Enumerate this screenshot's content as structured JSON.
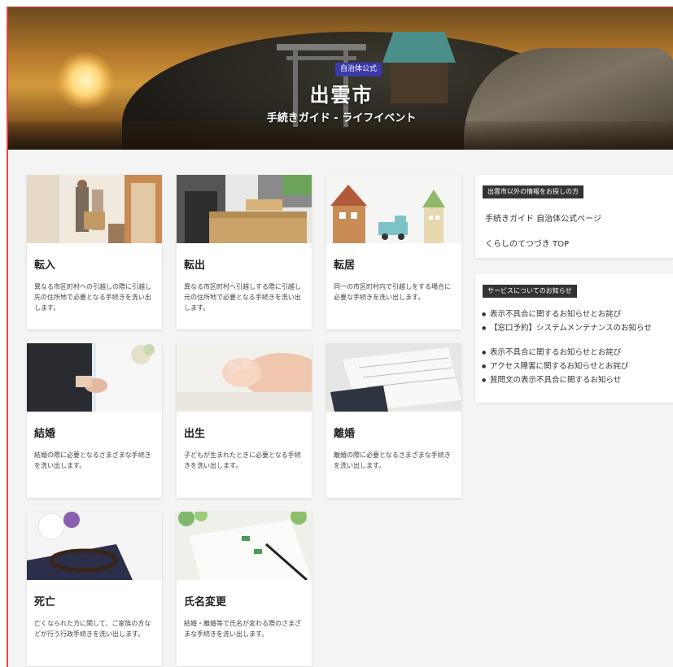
{
  "hero": {
    "badge": "自治体公式",
    "title": "出雲市",
    "subtitle": "手続きガイド - ライフイベント"
  },
  "cards": [
    {
      "title": "転入",
      "desc": "異なる市区町村への引越しの際に引越し先の住所地で必要となる手続きを洗い出します。"
    },
    {
      "title": "転出",
      "desc": "異なる市区町村へ引越しする際に引越し元の住所地で必要となる手続きを洗い出します。"
    },
    {
      "title": "転居",
      "desc": "同一の市区町村内で引越しをする場合に必要な手続きを洗い出します。"
    },
    {
      "title": "結婚",
      "desc": "結婚の際に必要となるさまざまな手続きを洗い出します。"
    },
    {
      "title": "出生",
      "desc": "子どもが生まれたときに必要となる手続きを洗い出します。"
    },
    {
      "title": "離婚",
      "desc": "離婚の際に必要となるさまざまな手続きを洗い出します。"
    },
    {
      "title": "死亡",
      "desc": "亡くなられた方に関して、ご家族の方などが行う行政手続きを洗い出します。"
    },
    {
      "title": "氏名変更",
      "desc": "結婚・離婚等で氏名が変わる際のさまざまな手続きを洗い出します。"
    }
  ],
  "side": {
    "other_label": "出雲市以外の情報をお探しの方",
    "links": [
      "手続きガイド 自治体公式ページ",
      "くらしのてつづき TOP"
    ],
    "notice_label": "サービスについてのお知らせ",
    "notices": [
      "表示不具合に関するお知らせとお詫び",
      "【窓口予約】システムメンテナンスのお知らせ",
      "表示不具合に関するお知らせとお詫び",
      "アクセス障害に関するお知らせとお詫び",
      "質問文の表示不具合に関するお知らせ"
    ]
  }
}
